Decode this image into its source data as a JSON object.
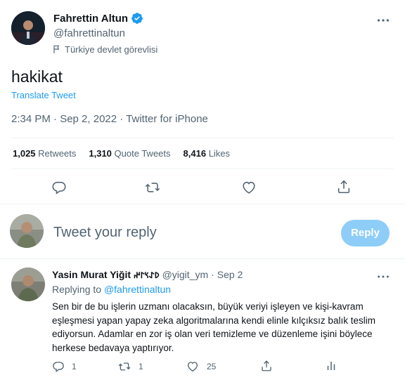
{
  "tweet": {
    "author_name": "Fahrettin Altun",
    "author_handle": "@fahrettinaltun",
    "label": "Türkiye devlet görevlisi",
    "text": "hakikat",
    "translate": "Translate Tweet",
    "timestamp": "2:34 PM · Sep 2, 2022 · Twitter for iPhone",
    "stats": {
      "retweets_count": "1,025",
      "retweets_label": "Retweets",
      "quotes_count": "1,310",
      "quotes_label": "Quote Tweets",
      "likes_count": "8,416",
      "likes_label": "Likes"
    }
  },
  "composer": {
    "placeholder": "Tweet your reply",
    "button": "Reply"
  },
  "reply": {
    "author_name": "Yasin Murat Yiğit",
    "runic": "𐰖𐰀𐰽𐰃𐰤",
    "author_handle": "@yigit_ym",
    "separator": "·",
    "date": "Sep 2",
    "replying_prefix": "Replying to",
    "replying_to": "@fahrettinaltun",
    "text": "Sen bir de bu işlerin uzmanı olacaksın, büyük veriyi işleyen ve kişi-kavram eşleşmesi yapan yapay zeka algoritmalarına kendi elinle kılçıksız balık teslim ediyorsun. Adamlar en zor iş olan veri temizleme ve düzenleme işini böylece herkese bedavaya yaptırıyor.",
    "counts": {
      "replies": "1",
      "retweets": "1",
      "likes": "25"
    }
  },
  "colors": {
    "accent": "#1d9bf0",
    "reply_button": "#8ecdf8",
    "muted_text": "#536471",
    "divider": "#eff3f4"
  },
  "icons": [
    "verified-badge-icon",
    "more-icon",
    "flag-icon",
    "reply-icon",
    "retweet-icon",
    "like-icon",
    "share-icon",
    "analytics-icon"
  ]
}
